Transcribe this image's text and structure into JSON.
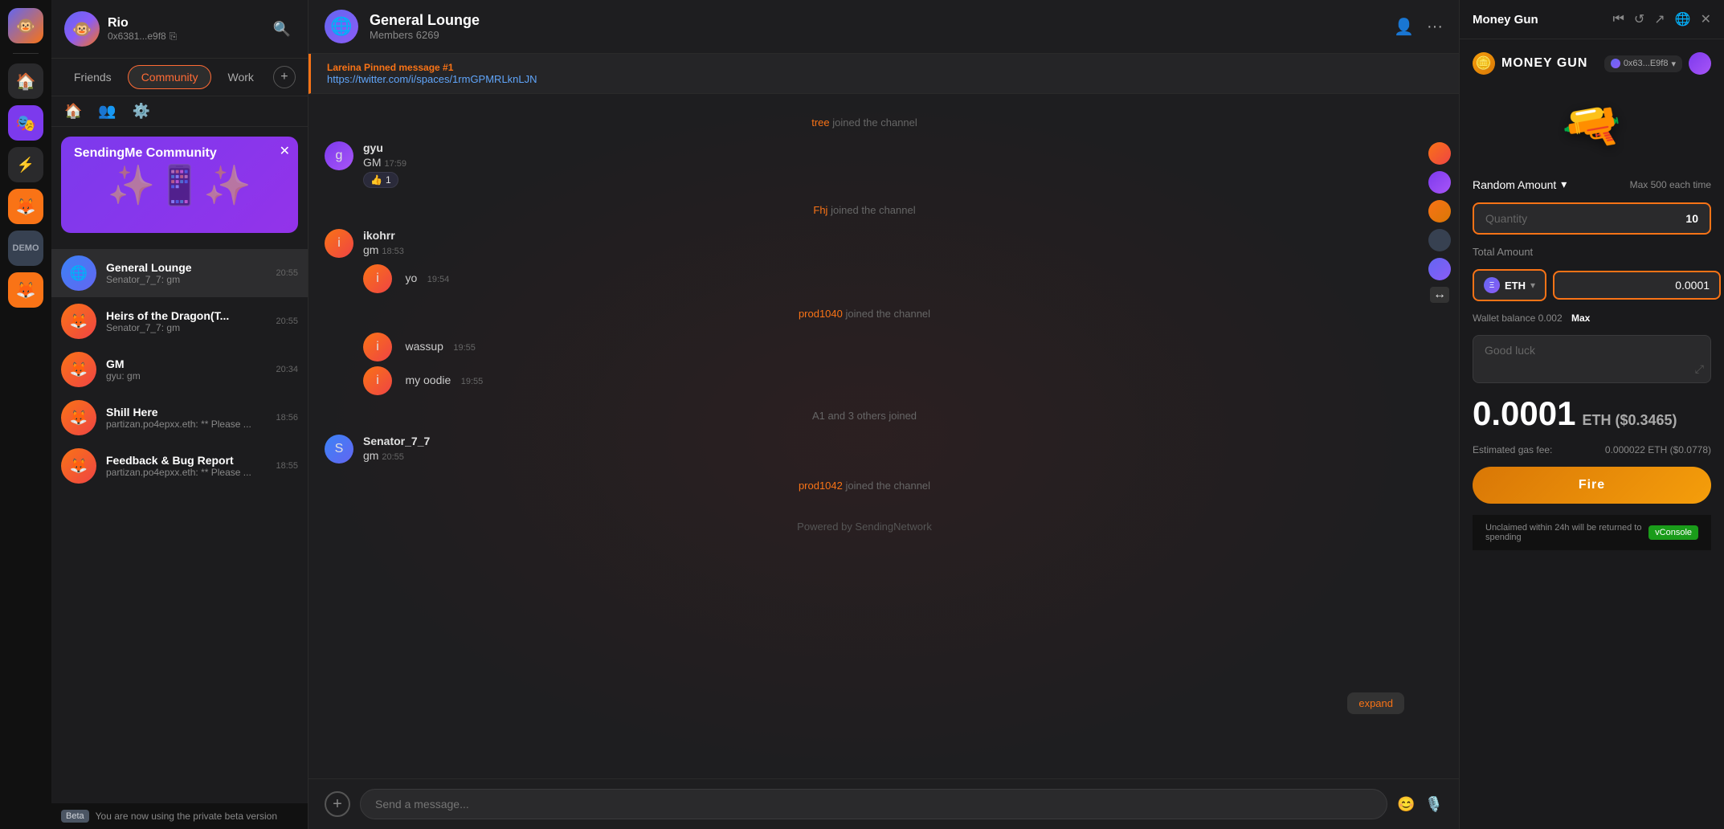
{
  "app": {
    "title": "Rio",
    "address": "0x6381...e9f8",
    "beta_label": "Beta",
    "beta_text": "You are now using the private beta version"
  },
  "icons": {
    "search": "🔍",
    "home": "🏠",
    "people": "👥",
    "settings": "⚙️",
    "compass": "🧭",
    "fox": "🦊",
    "friends_tab": "Friends",
    "community_tab": "Community",
    "work_tab": "Work",
    "add": "+",
    "copy": "⎘",
    "emoji": "😊",
    "mic": "🎙️",
    "close": "✕",
    "chevron_down": "▾",
    "expand": "↙"
  },
  "sidebar": {
    "tabs": [
      {
        "id": "friends",
        "label": "Friends"
      },
      {
        "id": "community",
        "label": "Community",
        "active": true
      },
      {
        "id": "work",
        "label": "Work"
      }
    ],
    "community_banner": {
      "name": "SendingMe Community"
    },
    "channels": [
      {
        "id": "general-lounge",
        "name": "General Lounge",
        "preview": "Senator_7_7: gm",
        "time": "20:55",
        "active": true,
        "avatar_type": "globe"
      },
      {
        "id": "heirs-dragon",
        "name": "Heirs of the Dragon(T...",
        "preview": "Senator_7_7: gm",
        "time": "20:55",
        "avatar_type": "fox"
      },
      {
        "id": "gm",
        "name": "GM",
        "preview": "gyu: gm",
        "time": "20:34",
        "avatar_type": "fox"
      },
      {
        "id": "shill-here",
        "name": "Shill Here",
        "preview": "partizan.po4epxx.eth: ** Please ...",
        "time": "18:56",
        "avatar_type": "fox"
      },
      {
        "id": "feedback",
        "name": "Feedback & Bug Report",
        "preview": "partizan.po4epxx.eth: ** Please ...",
        "time": "18:55",
        "avatar_type": "fox"
      }
    ]
  },
  "chat": {
    "channel_name": "General Lounge",
    "member_count": "Members 6269",
    "pinned": {
      "label": "Lareina Pinned message #1",
      "link": "https://twitter.com/i/spaces/1rmGPMRLknLJN"
    },
    "messages": [
      {
        "type": "system",
        "text_parts": [
          {
            "text": "tree",
            "highlight": true
          },
          {
            "text": " joined the channel",
            "highlight": false
          }
        ]
      },
      {
        "type": "user",
        "avatar": "purple",
        "author": "gyu",
        "lines": [
          {
            "text": "GM",
            "time": "17:59"
          }
        ],
        "reactions": [
          {
            "emoji": "👍",
            "count": "1"
          }
        ]
      },
      {
        "type": "system",
        "text_parts": [
          {
            "text": "Fhj",
            "highlight": true
          },
          {
            "text": " joined the channel",
            "highlight": false
          }
        ]
      },
      {
        "type": "user",
        "avatar": "orange",
        "author": "ikohrr",
        "lines": [
          {
            "text": "gm",
            "time": "18:53"
          },
          {
            "text": "yo",
            "time": "19:54"
          },
          {
            "text": "wassup",
            "time": "19:55"
          },
          {
            "text": "my oodie",
            "time": "19:55"
          }
        ]
      },
      {
        "type": "system",
        "text_parts": [
          {
            "text": "prod1040",
            "highlight": true
          },
          {
            "text": " joined the channel",
            "highlight": false
          }
        ]
      },
      {
        "type": "system",
        "text_parts": [
          {
            "text": "A1 and 3 others joined",
            "highlight": false
          }
        ]
      },
      {
        "type": "user",
        "avatar": "blue",
        "author": "Senator_7_7",
        "lines": [
          {
            "text": "gm",
            "time": "20:55"
          }
        ]
      },
      {
        "type": "system",
        "text_parts": [
          {
            "text": "prod1042",
            "highlight": true
          },
          {
            "text": " joined the channel",
            "highlight": false
          }
        ]
      }
    ],
    "powered_by": "Powered by SendingNetwork",
    "expand_label": "expand",
    "input_placeholder": "Send a message..."
  },
  "money_gun": {
    "panel_title": "Money Gun",
    "gun_name": "MONEY GUN",
    "address": "0x63...E9f8",
    "amount_type": "Random Amount",
    "max_label": "Max 500 each time",
    "quantity_label": "Quantity",
    "quantity_value": "10",
    "total_amount_label": "Total Amount",
    "currency": "ETH",
    "eth_amount": "0.0001",
    "wallet_balance": "Wallet balance 0.002",
    "max_link": "Max",
    "message_placeholder": "Good luck",
    "big_amount": "0.0001",
    "big_amount_suffix": "ETH ($0.3465)",
    "gas_fee_label": "Estimated gas fee:",
    "gas_fee_value": "0.000022 ETH ($0.0778)",
    "fire_button": "Fire",
    "unclaimed_text": "Unclaimed within 24h will be returned to spending",
    "vconsole": "vConsole"
  }
}
